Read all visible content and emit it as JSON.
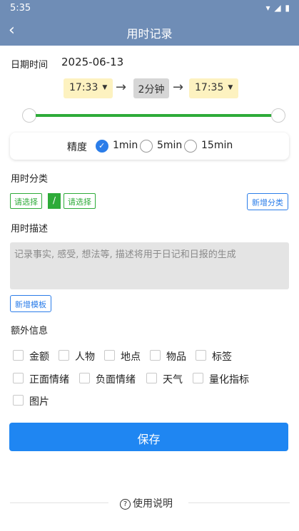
{
  "status_bar": {
    "time": "5:35"
  },
  "header": {
    "title": "用时记录"
  },
  "date_time": {
    "label": "日期时间",
    "date": "2025-06-13"
  },
  "time_range": {
    "start": "17:33",
    "duration": "2分钟",
    "end": "17:35"
  },
  "precision": {
    "label": "精度",
    "options": [
      {
        "label": "1min",
        "checked": true
      },
      {
        "label": "5min",
        "checked": false
      },
      {
        "label": "15min",
        "checked": false
      }
    ]
  },
  "category": {
    "label": "用时分类",
    "select1": "请选择",
    "separator": "/",
    "select2": "请选择",
    "add_button": "新增分类"
  },
  "description": {
    "label": "用时描述",
    "placeholder": "记录事实, 感受, 想法等, 描述将用于日记和日报的生成",
    "add_template": "新增模板"
  },
  "extra_info": {
    "label": "额外信息",
    "items": [
      "金额",
      "人物",
      "地点",
      "物品",
      "标签",
      "正面情绪",
      "负面情绪",
      "天气",
      "量化指标",
      "图片"
    ]
  },
  "save_button": "保存",
  "help": {
    "label": "使用说明"
  }
}
